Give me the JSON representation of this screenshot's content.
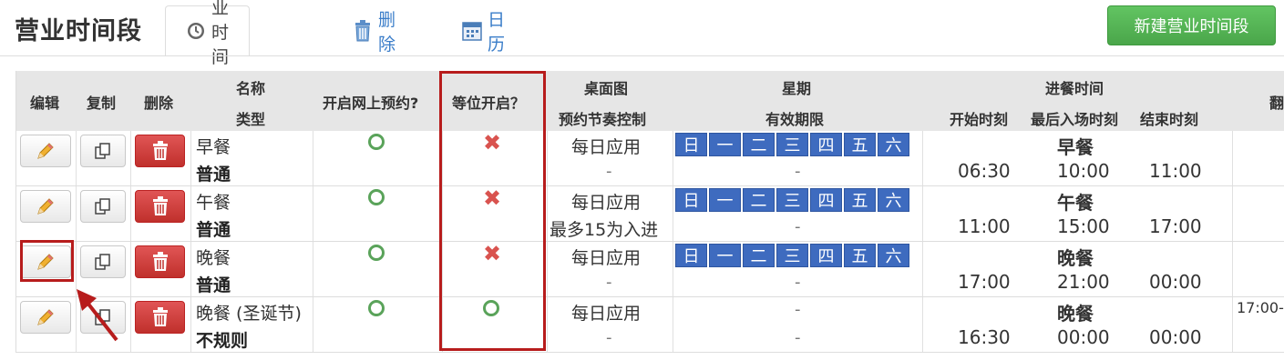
{
  "header": {
    "title": "营业时间段",
    "tabs": [
      {
        "label": "营业时间段",
        "icon": "clock-icon",
        "active": true
      },
      {
        "label": "删除",
        "icon": "trash-icon",
        "active": false
      },
      {
        "label": "日历",
        "icon": "calendar-icon",
        "active": false
      }
    ],
    "new_button": "新建营业时间段"
  },
  "columns": {
    "edit": "编辑",
    "copy": "复制",
    "delete": "删除",
    "name": "名称",
    "type": "类型",
    "online_booking": "开启网上预约?",
    "waitlist": "等位开启？",
    "table_map": "桌面图",
    "pacing": "预约节奏控制",
    "week": "星期",
    "validity": "有效期限",
    "dining_time": "进餐时间",
    "start": "开始时刻",
    "last_entry": "最后入场时刻",
    "end": "结束时刻",
    "cut_off": "翻"
  },
  "weekdays": [
    "日",
    "一",
    "二",
    "三",
    "四",
    "五",
    "六"
  ],
  "rows": [
    {
      "name": "早餐",
      "type": "普通",
      "online": true,
      "waitlist": false,
      "table_map": "每日应用",
      "pacing": "-",
      "show_days": true,
      "validity": "-",
      "meal": "早餐",
      "start": "06:30",
      "last_entry": "10:00",
      "end": "11:00",
      "extra": ""
    },
    {
      "name": "午餐",
      "type": "普通",
      "online": true,
      "waitlist": false,
      "table_map": "每日应用",
      "pacing": "最多15为入进",
      "show_days": true,
      "validity": "-",
      "meal": "午餐",
      "start": "11:00",
      "last_entry": "15:00",
      "end": "17:00",
      "extra": ""
    },
    {
      "name": "晚餐",
      "type": "普通",
      "online": true,
      "waitlist": false,
      "table_map": "每日应用",
      "pacing": "-",
      "show_days": true,
      "validity": "-",
      "meal": "晚餐",
      "start": "17:00",
      "last_entry": "21:00",
      "end": "00:00",
      "extra": ""
    },
    {
      "name": "晚餐 (圣诞节)",
      "type": "不规则",
      "online": true,
      "waitlist": true,
      "table_map": "每日应用",
      "pacing": "-",
      "show_days": false,
      "week": "-",
      "validity": "-",
      "meal": "晚餐",
      "start": "16:30",
      "last_entry": "00:00",
      "end": "00:00",
      "extra": "17:00-"
    }
  ],
  "colors": {
    "accent_red": "#b71c1c",
    "day_blue": "#3e6bbf",
    "green": "#5cb85c",
    "danger": "#d9534f"
  }
}
